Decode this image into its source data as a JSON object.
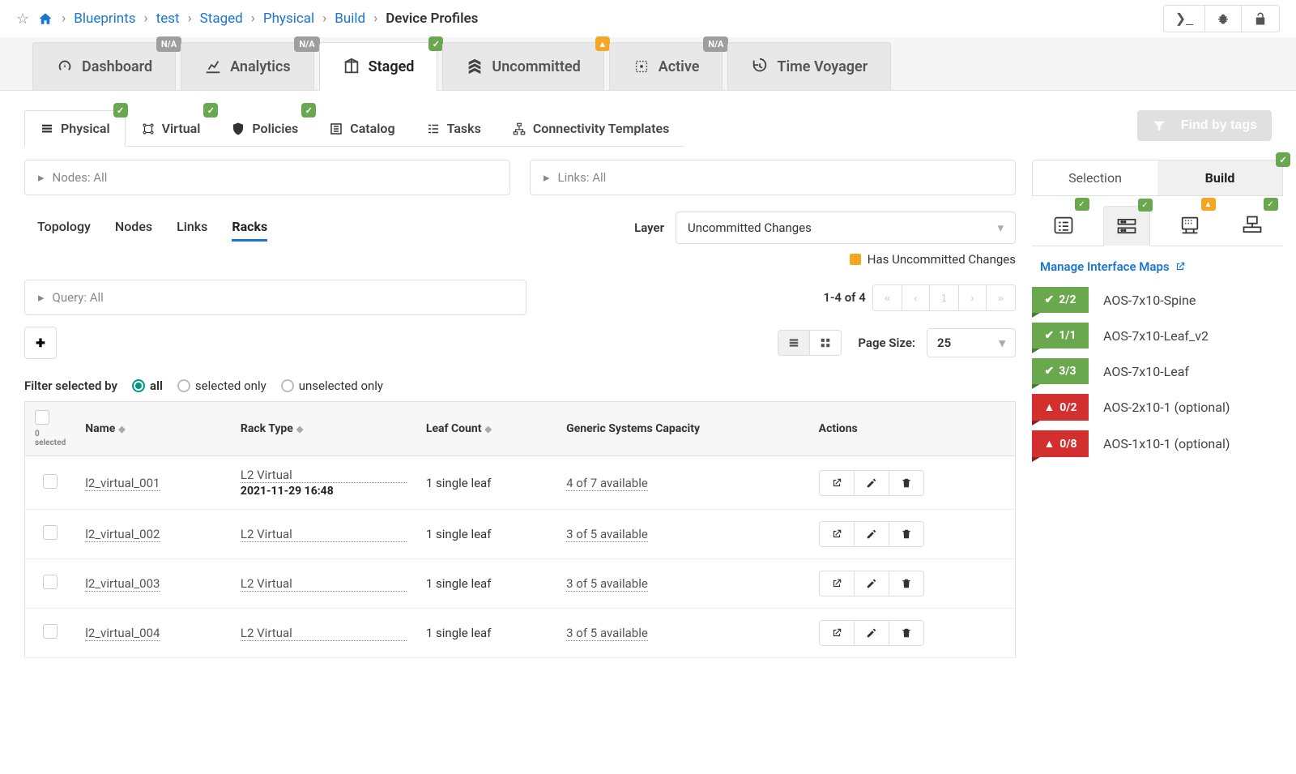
{
  "breadcrumb": [
    "Blueprints",
    "test",
    "Staged",
    "Physical",
    "Build"
  ],
  "breadcrumb_current": "Device Profiles",
  "main_tabs": [
    {
      "label": "Dashboard",
      "badge": "N/A",
      "badge_type": "na"
    },
    {
      "label": "Analytics",
      "badge": "N/A",
      "badge_type": "na"
    },
    {
      "label": "Staged",
      "badge": "✓",
      "badge_type": "ok"
    },
    {
      "label": "Uncommitted",
      "badge": "!",
      "badge_type": "warn"
    },
    {
      "label": "Active",
      "badge": "N/A",
      "badge_type": "na"
    },
    {
      "label": "Time Voyager",
      "badge": "",
      "badge_type": ""
    }
  ],
  "active_main_tab": "Staged",
  "sub_tabs": [
    "Physical",
    "Virtual",
    "Policies",
    "Catalog",
    "Tasks",
    "Connectivity Templates"
  ],
  "active_sub_tab": "Physical",
  "sub_tab_badges": {
    "Physical": "ok",
    "Virtual": "ok",
    "Policies": "ok"
  },
  "find_by_tags": "Find by tags",
  "nodes_bar": "Nodes: All",
  "links_bar": "Links: All",
  "tnl_tabs": [
    "Topology",
    "Nodes",
    "Links",
    "Racks"
  ],
  "active_tnl": "Racks",
  "layer_label": "Layer",
  "layer_value": "Uncommitted Changes",
  "legend_text": "Has Uncommitted Changes",
  "query_bar": "Query: All",
  "pager_info": "1-4 of 4",
  "page_size_label": "Page Size:",
  "page_size_value": "25",
  "filter_label": "Filter selected by",
  "filter_options": [
    "all",
    "selected only",
    "unselected only"
  ],
  "filter_selected": "all",
  "table": {
    "selected_count": "0 selected",
    "headers": [
      "Name",
      "Rack Type",
      "Leaf Count",
      "Generic Systems Capacity",
      "Actions"
    ],
    "rows": [
      {
        "name": "l2_virtual_001",
        "rack_type": "L2 Virtual",
        "rack_ts": "2021-11-29 16:48",
        "leaf": "1 single leaf",
        "capacity": "4 of 7 available"
      },
      {
        "name": "l2_virtual_002",
        "rack_type": "L2 Virtual",
        "rack_ts": "",
        "leaf": "1 single leaf",
        "capacity": "3 of 5 available"
      },
      {
        "name": "l2_virtual_003",
        "rack_type": "L2 Virtual",
        "rack_ts": "",
        "leaf": "1 single leaf",
        "capacity": "3 of 5 available"
      },
      {
        "name": "l2_virtual_004",
        "rack_type": "L2 Virtual",
        "rack_ts": "",
        "leaf": "1 single leaf",
        "capacity": "3 of 5 available"
      }
    ]
  },
  "right": {
    "tabs": [
      "Selection",
      "Build"
    ],
    "active": "Build",
    "badge": "ok",
    "icon_badges": [
      "ok",
      "ok",
      "warn",
      "ok"
    ],
    "active_icon": 1,
    "manage_link": "Manage Interface Maps",
    "devices": [
      {
        "status": "ok",
        "count": "2/2",
        "label": "AOS-7x10-Spine"
      },
      {
        "status": "ok",
        "count": "1/1",
        "label": "AOS-7x10-Leaf_v2"
      },
      {
        "status": "ok",
        "count": "3/3",
        "label": "AOS-7x10-Leaf"
      },
      {
        "status": "err",
        "count": "0/2",
        "label": "AOS-2x10-1 (optional)"
      },
      {
        "status": "err",
        "count": "0/8",
        "label": "AOS-1x10-1 (optional)"
      }
    ]
  }
}
